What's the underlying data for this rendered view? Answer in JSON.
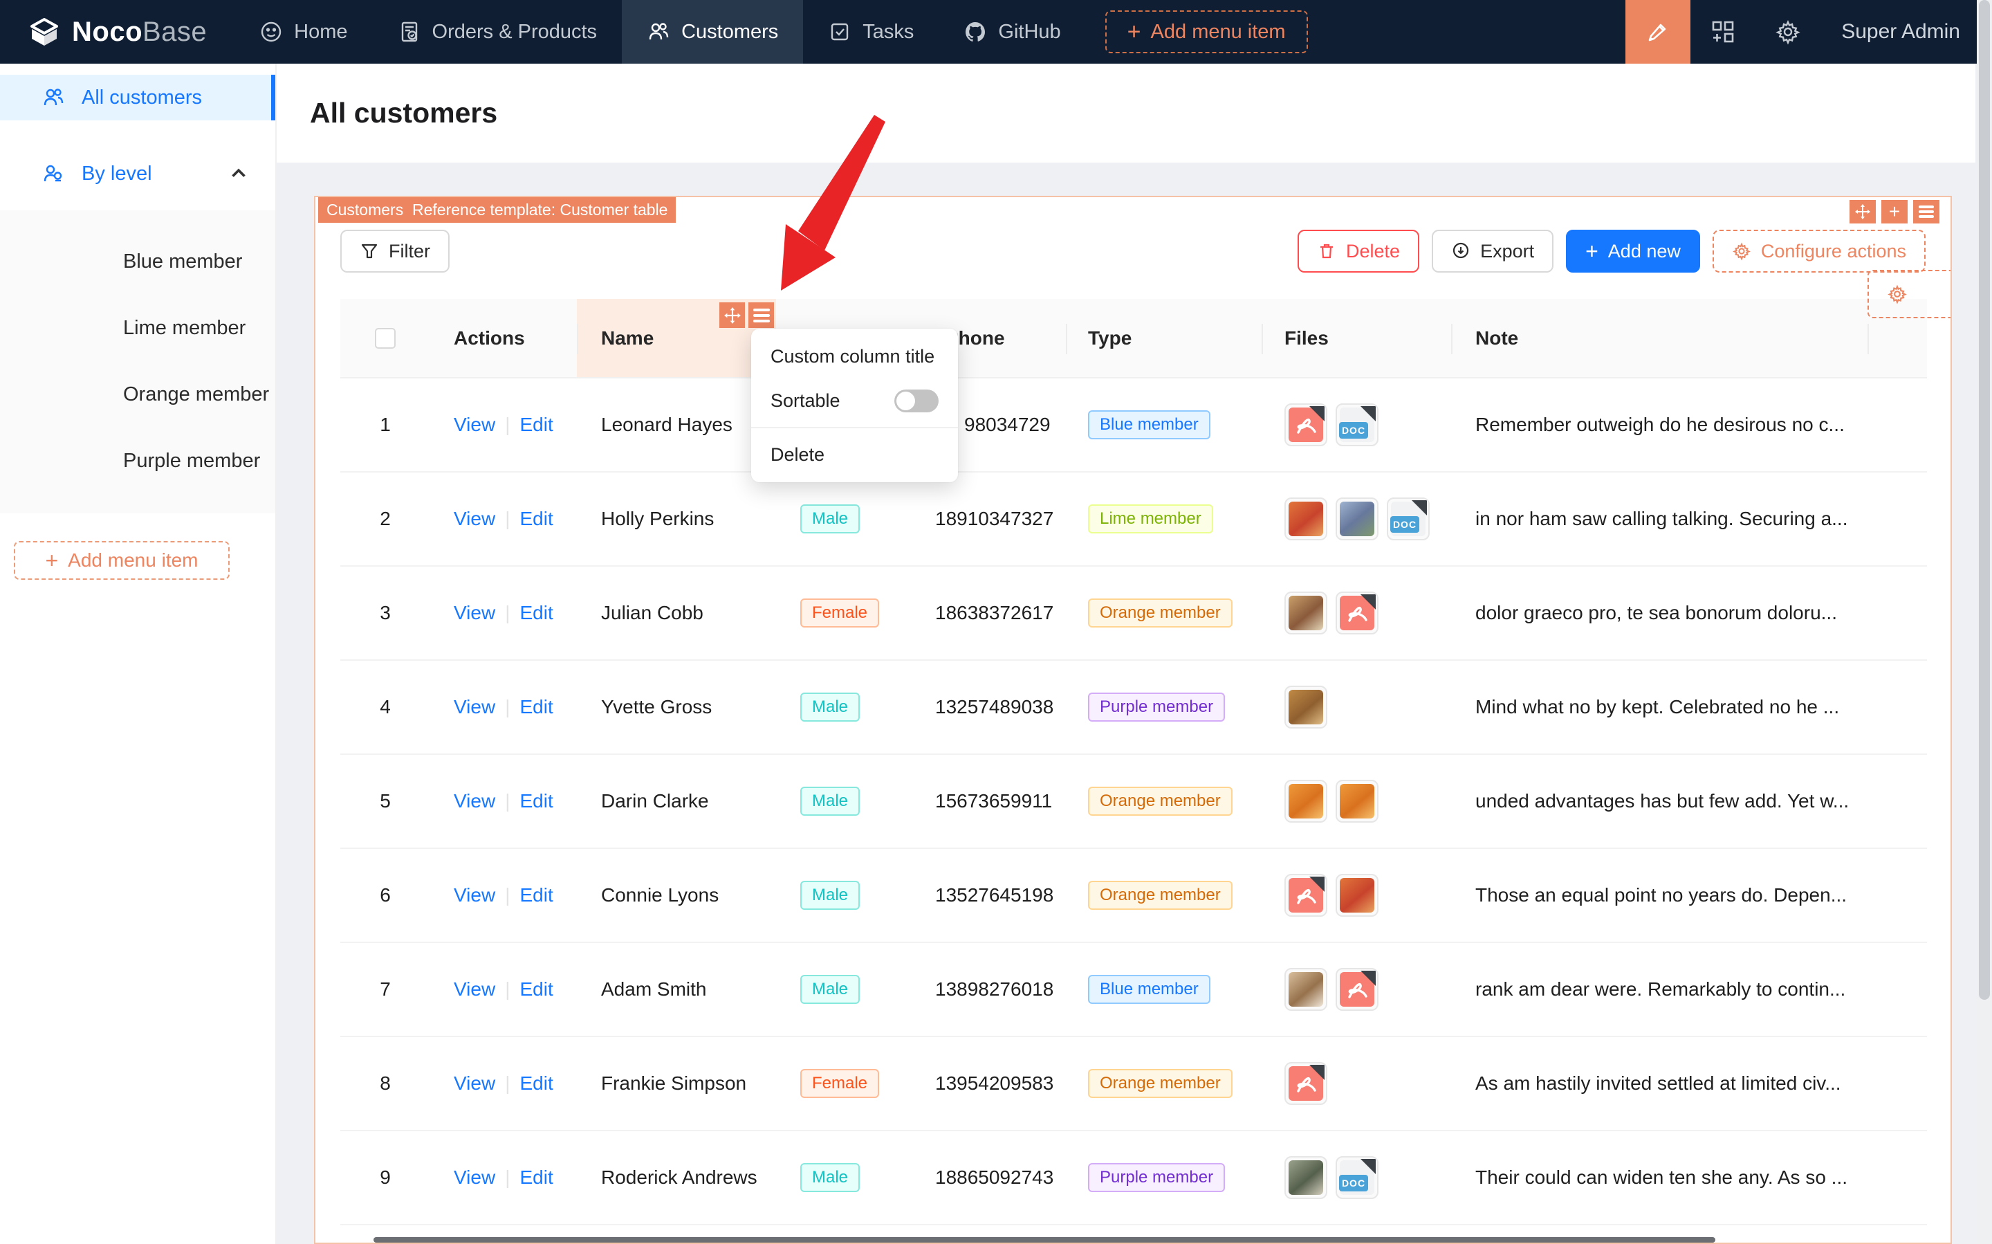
{
  "colors": {
    "accent_orange": "#EC8560",
    "primary_blue": "#1677FF",
    "danger_red": "#FF4D4F",
    "arrow_red": "#E82427",
    "nav_bg": "#101E33"
  },
  "nav": {
    "brand_bold": "Noco",
    "brand_light": "Base",
    "items": [
      {
        "label": "Home"
      },
      {
        "label": "Orders & Products"
      },
      {
        "label": "Customers"
      },
      {
        "label": "Tasks"
      },
      {
        "label": "GitHub"
      }
    ],
    "add_item": "Add menu item",
    "user": "Super Admin"
  },
  "sidebar": {
    "all_customers": "All customers",
    "by_level": "By level",
    "levels": [
      "Blue member",
      "Lime member",
      "Orange member",
      "Purple member"
    ],
    "add_item": "Add menu item"
  },
  "page": {
    "title": "All customers"
  },
  "block": {
    "tags": [
      "Customers",
      "Reference template: Customer table"
    ],
    "toolbar": {
      "filter": "Filter",
      "delete": "Delete",
      "export": "Export",
      "add_new": "Add new",
      "configure_actions": "Configure actions"
    }
  },
  "menu": {
    "items": [
      "Custom column title",
      "Sortable",
      "Delete"
    ],
    "sortable_state": "off"
  },
  "labels": {
    "doc": "DOC"
  },
  "table": {
    "headers": {
      "actions": "Actions",
      "name": "Name",
      "phone": "Phone",
      "type": "Type",
      "files": "Files",
      "note": "Note"
    },
    "rows": [
      {
        "idx": "1",
        "actions": [
          "View",
          "Edit"
        ],
        "name": "Leonard Hayes",
        "gender": null,
        "gender_key": null,
        "phone": "98034729",
        "phone_partial": true,
        "type": "Blue member",
        "type_key": "blue",
        "files": [
          {
            "kind": "pdf"
          },
          {
            "kind": "doc"
          }
        ],
        "note": "Remember outweigh do he desirous no c..."
      },
      {
        "idx": "2",
        "actions": [
          "View",
          "Edit"
        ],
        "name": "Holly Perkins",
        "gender": "Male",
        "gender_key": "male",
        "phone": "18910347327",
        "phone_partial": false,
        "type": "Lime member",
        "type_key": "lime",
        "files": [
          {
            "kind": "img",
            "tone": "fruit-red"
          },
          {
            "kind": "img",
            "tone": "berry"
          },
          {
            "kind": "doc"
          }
        ],
        "note": "in nor ham saw calling talking. Securing a..."
      },
      {
        "idx": "3",
        "actions": [
          "View",
          "Edit"
        ],
        "name": "Julian Cobb",
        "gender": "Female",
        "gender_key": "female",
        "phone": "18638372617",
        "phone_partial": false,
        "type": "Orange member",
        "type_key": "orange",
        "files": [
          {
            "kind": "img",
            "tone": "food"
          },
          {
            "kind": "pdf"
          }
        ],
        "note": "dolor graeco pro, te sea bonorum doloru..."
      },
      {
        "idx": "4",
        "actions": [
          "View",
          "Edit"
        ],
        "name": "Yvette Gross",
        "gender": "Male",
        "gender_key": "male",
        "phone": "13257489038",
        "phone_partial": false,
        "type": "Purple member",
        "type_key": "purple",
        "files": [
          {
            "kind": "img",
            "tone": "cookies"
          }
        ],
        "note": "Mind what no by kept. Celebrated no he ..."
      },
      {
        "idx": "5",
        "actions": [
          "View",
          "Edit"
        ],
        "name": "Darin Clarke",
        "gender": "Male",
        "gender_key": "male",
        "phone": "15673659911",
        "phone_partial": false,
        "type": "Orange member",
        "type_key": "orange",
        "files": [
          {
            "kind": "img",
            "tone": "oranges"
          },
          {
            "kind": "img",
            "tone": "oranges"
          }
        ],
        "note": "unded advantages has but few add. Yet w..."
      },
      {
        "idx": "6",
        "actions": [
          "View",
          "Edit"
        ],
        "name": "Connie Lyons",
        "gender": "Male",
        "gender_key": "male",
        "phone": "13527645198",
        "phone_partial": false,
        "type": "Orange member",
        "type_key": "orange",
        "files": [
          {
            "kind": "pdf"
          },
          {
            "kind": "img",
            "tone": "fruit-red"
          }
        ],
        "note": "Those an equal point no years do. Depen..."
      },
      {
        "idx": "7",
        "actions": [
          "View",
          "Edit"
        ],
        "name": "Adam Smith",
        "gender": "Male",
        "gender_key": "male",
        "phone": "13898276018",
        "phone_partial": false,
        "type": "Blue member",
        "type_key": "blue",
        "files": [
          {
            "kind": "img",
            "tone": "latte"
          },
          {
            "kind": "pdf"
          }
        ],
        "note": "rank am dear were. Remarkably to contin..."
      },
      {
        "idx": "8",
        "actions": [
          "View",
          "Edit"
        ],
        "name": "Frankie Simpson",
        "gender": "Female",
        "gender_key": "female",
        "phone": "13954209583",
        "phone_partial": false,
        "type": "Orange member",
        "type_key": "orange",
        "files": [
          {
            "kind": "pdf"
          }
        ],
        "note": "As am hastily invited settled at limited civ..."
      },
      {
        "idx": "9",
        "actions": [
          "View",
          "Edit"
        ],
        "name": "Roderick Andrews",
        "gender": "Male",
        "gender_key": "male",
        "phone": "18865092743",
        "phone_partial": false,
        "type": "Purple member",
        "type_key": "purple",
        "files": [
          {
            "kind": "img",
            "tone": "street"
          },
          {
            "kind": "doc"
          }
        ],
        "note": "Their could can widen ten she any. As so ..."
      }
    ]
  }
}
